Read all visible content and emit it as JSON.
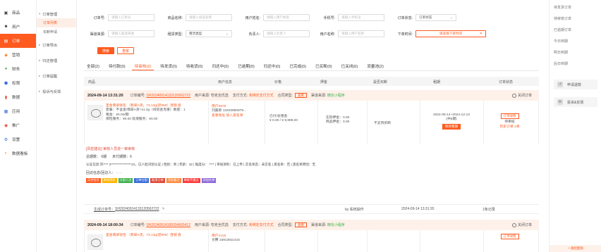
{
  "sidebar": {
    "items": [
      {
        "label": "商品",
        "icon": "box-icon"
      },
      {
        "label": "用户",
        "icon": "user-icon"
      },
      {
        "label": "订单",
        "icon": "order-icon"
      },
      {
        "label": "营销",
        "icon": "megaphone-icon"
      },
      {
        "label": "财务",
        "icon": "finance-icon"
      },
      {
        "label": "权限",
        "icon": "shield-icon"
      },
      {
        "label": "数据",
        "icon": "chart-icon"
      },
      {
        "label": "应用",
        "icon": "grid-icon"
      },
      {
        "label": "推广",
        "icon": "share-icon"
      },
      {
        "label": "设置",
        "icon": "gear-icon"
      },
      {
        "label": "数据看板",
        "icon": "dashboard-icon"
      }
    ],
    "active_index": 2
  },
  "submenu": {
    "order_manage": "订单管理",
    "order_list": "订单列表",
    "buyout_apply": "买断申请",
    "order_export": "订单导出",
    "rent_return": "归还管理",
    "order_remind": "订单提醒",
    "complaints": "投诉与反馈"
  },
  "filters": {
    "order_no_label": "订单号:",
    "order_no_ph": "请输入订单号",
    "goods_name_label": "商品名称:",
    "goods_name_ph": "请输入商品名称",
    "user_name_label": "用户姓名:",
    "user_name_ph": "请输入用户姓名",
    "phone_label": "手机号:",
    "phone_ph": "请输入手机号",
    "status_label": "订单状态:",
    "status_ph": "订单状态",
    "channel_label": "渠道来源:",
    "channel_ph": "请输入渠道来源",
    "rent_type_label": "租赁类型:",
    "rent_type_ph": "租赁类型",
    "owner_label": "负责人:",
    "owner_ph": "请输入负责人",
    "user_name2_label": "用户名称:",
    "user_name2_ph": "请输入用户名称",
    "order_time_label": "下单时间:",
    "order_time_ph": "请选择下单时间",
    "search_btn": "搜索",
    "reset_btn": "重置"
  },
  "tabs": [
    {
      "label": "全部(2)"
    },
    {
      "label": "待付款(0)"
    },
    {
      "label": "待审核(2)"
    },
    {
      "label": "待发货(0)"
    },
    {
      "label": "待收货(0)"
    },
    {
      "label": "归还中(0)"
    },
    {
      "label": "已逾期(0)"
    },
    {
      "label": "归还中(0)"
    },
    {
      "label": "已完成(0)"
    },
    {
      "label": "已买断(0)"
    },
    {
      "label": "已关闭(0)"
    },
    {
      "label": "流量池(2)"
    }
  ],
  "table_headers": {
    "goods": "商品",
    "user": "用户信息",
    "price": "价格",
    "deposit": "押金",
    "buyout": "是否买断",
    "term": "租期",
    "status": "订单状态"
  },
  "order1": {
    "date": "2024-09-14 13:31:20",
    "order_no_label": "订单编号:",
    "order_no": "SH20240914133120562722",
    "user_source": "用户来源: 夸克全优选",
    "pay_method_label": "支付方式:",
    "pay_method": "未绑定支付方式",
    "contract_label": "合同类型:",
    "contract_btn": "查看",
    "channel_label": "渠道来源:",
    "channel": "微信小程序",
    "close": "关闭订单",
    "goods_title": "圣金翡翠钱包 （翡翠A货，73.13g(足999）连锁 各",
    "goods_spec": "套餐：不含金/翡翠A货+11.2g（线装金克重）数量：1",
    "goods_price": "租金：¥0.00/期",
    "goods_deposit": "保险服务：¥0.00   延保服务：¥0.00",
    "user_id": "用户0878",
    "user_name": "刘嘉新 13203860878...",
    "user_remark": "查看地址 加入黑名单",
    "price_line1": "已付/总租金:",
    "price_line2": "¥ 0.00  / ¥ 9,999.00",
    "deposit_line1": "实际押金：0.00",
    "deposit_line2": "商品押金：0.00",
    "buyout": "不支持买断",
    "term": "2024-09-14~2024-12-13",
    "term_count": "(共6期)",
    "term_btn": "修改租期",
    "status_badge": "订单详情",
    "status_text": "待审核",
    "status_link": "历史订单 1单"
  },
  "risk": {
    "title": "[风控建议] 审核人员进一审审核",
    "total_periods": "总期数：  6期",
    "unpaid": "未付期数：6",
    "info": "认证信息:刘**** 3****************1X，已人脸识别认证 |  性别：男 |  年龄：32  |  粘度分：  ****  |  审核资料：已上传  |  实名状态：未实名  | 黑名单：否 |  黑名单原因：无",
    "followup": "回访信息/回访人：   ·  · ·",
    "tags": [
      "风控信息",
      "审核资料",
      "分配人员",
      "订单分配",
      "取消订单",
      "添加备注",
      "审核不通过",
      "添加名单"
    ]
  },
  "order1_footer": {
    "generate_label": "生成订单号：",
    "generate_no": "SH20240914133120562722",
    "op": "by 系统操作",
    "op_time": "2024-09-14 13:31:20",
    "records": "1条记录"
  },
  "order2": {
    "date": "2024-09-14 18:00:34",
    "order_no_label": "订单编号:",
    "order_no": "SH20240914180034665412",
    "user_source": "用户来源: 夸克全优选",
    "pay_method_label": "支付方式:",
    "pay_method": "未绑定支付方式",
    "contract_label": "合同类型:",
    "contract_btn": "查看",
    "channel_label": "渠道来源:",
    "channel": "微信小程序",
    "close": "关闭订单",
    "goods_title": "圣金翡翠钱包 （翡翠A货，73.13g(足999）连锁 各",
    "user_id": "用户1415",
    "user_name": "文腾 15913811415",
    "status_badge": "订单详情"
  },
  "right_panel": {
    "items": [
      "待发货订单",
      "待审核订单",
      "已逾期订单",
      "今日到期",
      "明日到期",
      "后日到期"
    ],
    "box1": "申请退款",
    "box2": "投诉&反馈",
    "bottom": "+ 收起面板"
  },
  "colors": {
    "accent": "#ff5a1f",
    "green": "#3fb24d"
  }
}
